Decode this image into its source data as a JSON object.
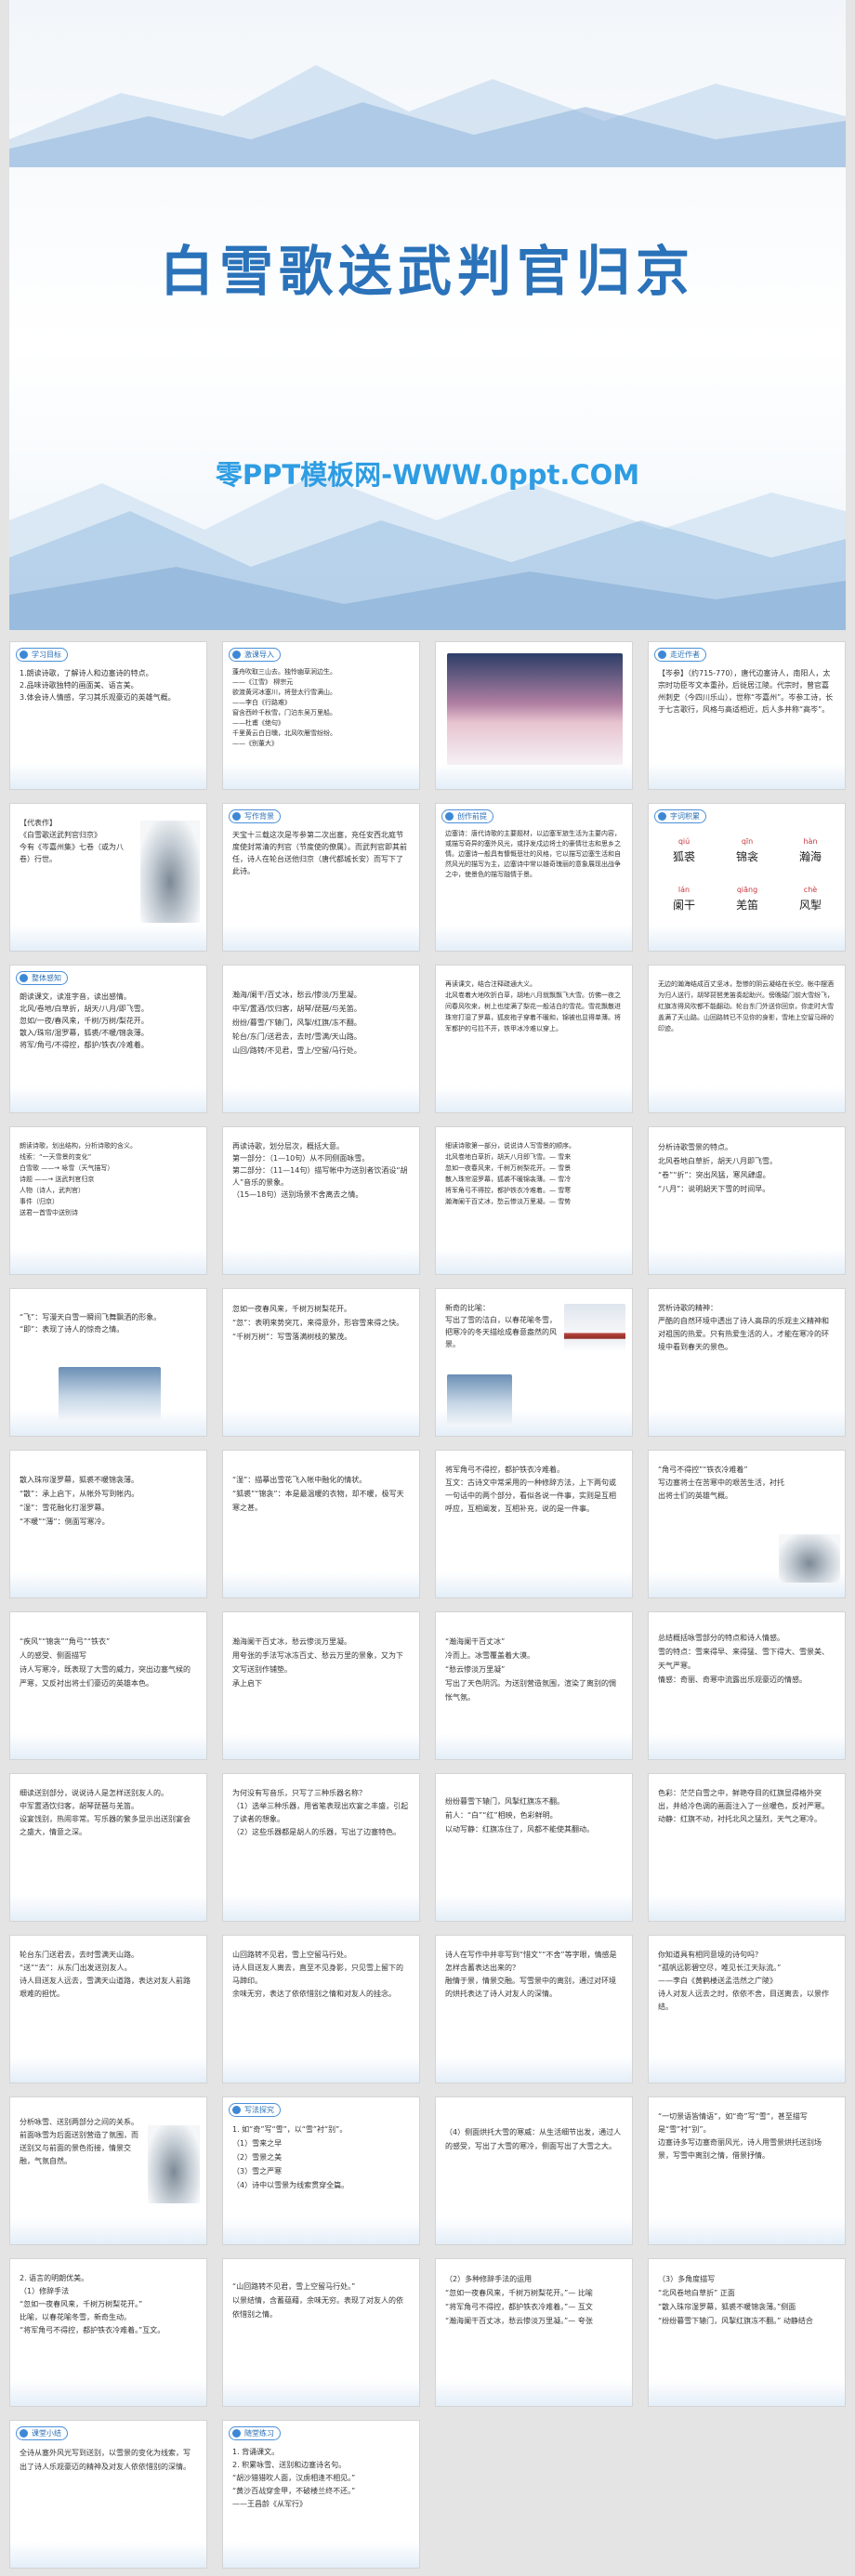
{
  "hero": {
    "title": "白雪歌送武判官归京",
    "subtitle": "零PPT模板网-WWW.0ppt.COM"
  },
  "tags": {
    "s1": "学习目标",
    "s2": "激课导入",
    "s4": "走近作者",
    "s6": "写作背景",
    "s7": "创作前提",
    "s8": "字词积累",
    "s9": "整体感知",
    "s19": "细读课文",
    "s41": "课堂小结",
    "s42": "随堂练习",
    "s37": "写法探究"
  },
  "slides": {
    "s1": "1.朗读诗歌，了解诗人和边塞诗的特点。\n2.品味诗歌独特的画面美、语言美。\n3.体会诗人情感，学习其乐观豪迈的英雄气概。",
    "s2": "蓬舟吹取三山去。独怜幽草涧边生。\n——《江雪》 柳宗元\n欲渡黄河冰塞川，将登太行雪满山。\n——李白《行路难》\n窗含西岭千秋雪，门泊东吴万里船。\n——杜甫《绝句》\n千里黄云白日曛，北风吹雁雪纷纷。\n——《别董大》",
    "s4": "【岑参】（约715-770），唐代边塞诗人，南阳人，太宗时功臣岑文本重孙，后徙居江陵。代宗时，曾官嘉州刺史（今四川乐山），世称“岑嘉州”。岑参工诗，长于七言歌行，风格与高适相近，后人多并称“高岑”。",
    "s5": "【代表作】\n《白雪歌送武判官归京》\n今有《岑嘉州集》七卷（或为八卷）行世。",
    "s6": "天宝十三载这次是岑参第二次出塞，充任安西北庭节度使封常清的判官（节度使的僚属）。而武判官即其前任，诗人在轮台送他归京（唐代都城长安）而写下了此诗。",
    "s7": "边塞诗：唐代诗歌的主要题材，以边塞军旅生活为主要内容，或描写奇异的塞外风光，或抒发戍边将士的豪情壮志和思乡之情。边塞诗一般具有慷慨悲壮的风格，它以描写边塞生活和自然风光的描写为主，边塞诗中常以雄奇瑰丽的意象展现出战争之中，使景色的描写融情于景。",
    "s8_pinyin": [
      "qiú",
      "qīn",
      "hàn",
      "lán",
      "qiāng",
      "chè"
    ],
    "s8_words": [
      "狐裘",
      "锦衾",
      "瀚海",
      "阑干",
      "羌笛",
      "风掣"
    ],
    "s9": "朗读课文，读准字音，读出感情。\n北风/卷地/白草折，胡天/八月/即飞雪。\n忽如/一夜/春风来，千树/万树/梨花开。\n散入/珠帘/湿罗幕，狐裘/不暖/锦衾薄。\n将军/角弓/不得控，都护/铁衣/冷难着。",
    "s10": "瀚海/阑干/百丈冰，愁云/惨淡/万里凝。\n中军/置酒/饮归客，胡琴/琵琶/与羌笛。\n纷纷/暮雪/下辕门，风掣/红旗/冻不翻。\n轮台/东门/送君去，去时/雪满/天山路。\n山回/路转/不见君，雪上/空留/马行处。",
    "s11": "再读课文，结合注释疏通大义。\n北风卷着大地吹折白草，胡地八月就飘飘飞大雪。仿佛一夜之间春风吹来，树上也绽满了梨花一般洁白的雪花。雪花飘散进珠帘打湿了罗幕，狐皮袍子穿着不暖和，锦被也显得单薄。将军都护的弓拉不开，铁甲冰冷难以穿上。",
    "s12": "无边的瀚海结成百丈坚冰，愁惨的阴云凝结在长空。帐中摆酒为归人送行，胡琴琵琶羌笛奏起助兴。傍晚辕门前大雪纷飞，红旗冻得风吹都不能翻动。轮台东门外送你回京，你走时大雪盖满了天山路。山回路转已不见你的身影，雪地上空留马蹄的印迹。",
    "s13": "朗读诗歌，划出结构，分析诗歌的含义。\n线索：“一天雪景的变化”\n白雪歌 ——→ 咏雪（天气描写）\n诗题 ——→ 送武判官归京\n人物（诗人，武判官）\n事件（归京）\n送君一首雪中送别诗",
    "s14": "再读诗歌，划分层次，概括大意。\n第一部分：（1—10句）从不同侧面咏雪。\n第二部分：（11—14句）描写帐中为送别者饮酒设“胡人”音乐的景象。\n（15—18句）送别场景不舍离去之情。",
    "s15": "细读诗歌第一部分，说说诗人写雪景的顺序。\n北风卷地白草折，胡天八月即飞雪。— 雪来\n忽如一夜春风来，千树万树梨花开。— 雪景\n散入珠帘湿罗幕，狐裘不暖锦衾薄。— 雪冷\n将军角弓不得控，都护铁衣冷难着。— 雪寒\n瀚海阑干百丈冰，愁云惨淡万里凝。— 雪势",
    "s16": "分析诗歌雪景的特点。\n北风卷地白草折，胡天八月即飞雪。\n“卷”“折”：突出风猛，寒风肆虐。\n“八月”：说明胡天下雪的时间早。",
    "s17": "“飞”：写漫天白雪一瞬间飞舞飘洒的形象。\n“即”：表现了诗人的惊奇之情。",
    "s18": "忽如一夜春风来，千树万树梨花开。\n“忽”：表明来势突兀，来得意外，形容雪来得之快。\n“千树万树”：写雪落满树枝的繁茂。",
    "s19": "新奇的比喻：\n写出了雪的洁白，以春花喻冬雪，把寒冷的冬天描绘成春意盎然的风景。",
    "s20": "赏析诗歌的精神：\n严酷的自然环境中透出了诗人高昂的乐观主义精神和对祖国的热爱。只有热爱生活的人，才能在寒冷的环境中看到春天的景色。",
    "s21": "散入珠帘湿罗幕，狐裘不暖锦衾薄。\n“散”：承上启下，从帐外写到帐内。\n“湿”：雪花融化打湿罗幕。\n“不暖”“薄”：侧面写寒冷。",
    "s22": "“湿”：描摹出雪花飞入帐中融化的情状。\n“狐裘”“锦衾”：本是最温暖的衣物，却不暖，极写天寒之甚。",
    "s23": "将军角弓不得控，都护铁衣冷难着。\n互文：古诗文中常采用的一种修辞方法，上下两句或一句话中的两个部分，看似各说一件事，实则是互相呼应，互相阐发，互相补充，说的是一件事。",
    "s24": "“角弓不得控”“铁衣冷难着”\n写边塞将士在苦寒中的艰苦生活，衬托出将士们的英雄气概。",
    "s25": "“疾风”“锦衾”“角弓”“铁衣”\n人的感受、侧面描写\n诗人写寒冷，既表现了大雪的威力，突出边塞气候的严寒，又反衬出将士们豪迈的英雄本色。",
    "s26": "瀚海阑干百丈冰，愁云惨淡万里凝。\n用夸张的手法写冰冻百丈、愁云万里的景象，又为下文写送别作铺垫。\n承上启下",
    "s27": "“瀚海阑干百丈冰”\n冷而上。冰雪覆盖着大漠。\n“愁云惨淡万里凝”\n写出了天色阴沉。为送别营造氛围，渲染了离别的惆怅气氛。",
    "s28": "总结概括咏雪部分的特点和诗人情感。\n雪的特点：雪来得早、来得猛、雪下得大、雪景美、天气严寒。\n情感：奇丽、奇寒中流露出乐观豪迈的情感。",
    "s29": "细读送别部分，说说诗人是怎样送别友人的。\n中军置酒饮归客，胡琴琵琶与羌笛。\n设宴饯别，热闹非常。写乐器的繁多显示出送别宴会之盛大，情意之深。",
    "s30": "为何没有写音乐，只写了三种乐器名称？\n（1）选举三种乐器，用省笔表现出欢宴之丰盛，引起了读者的想象。\n（2）这些乐器都是胡人的乐器，写出了边塞特色。",
    "s31": "纷纷暮雪下辕门，风掣红旗冻不翻。\n前人：“白”“红”相映，色彩鲜明。\n以动写静：红旗冻住了，风都不能使其翻动。",
    "s32": "色彩：茫茫白雪之中，鲜艳夺目的红旗显得格外突出，并给冷色调的画面注入了一丝暖色，反衬严寒。\n动静：红旗不动，衬托北风之猛烈，天气之寒冷。",
    "s33": "轮台东门送君去，去时雪满天山路。\n“送”“去”：从东门出发送别友人。\n诗人目送友人远去，雪满天山道路，表达对友人前路艰难的担忧。",
    "s34": "山回路转不见君，雪上空留马行处。\n诗人目送友人离去，直至不见身影，只见雪上留下的马蹄印。\n余味无穷，表达了依依惜别之情和对友人的挂念。",
    "s35": "诗人在写作中并非写到“惜文”“不舍”等字眼，情感是怎样含蓄表达出来的？\n融情于景，情景交融。写雪景中的离别，通过对环境的烘托表达了诗人对友人的深情。",
    "s36": "你知道具有相同意境的诗句吗？\n“孤帆远影碧空尽，唯见长江天际流。”\n——李白《黄鹤楼送孟浩然之广陵》\n诗人对友人远去之时，依依不舍，目送离去，以景作结。",
    "s37": "分析咏雪、送别两部分之间的关系。\n前面咏雪为后面送别营造了氛围，而送别又与前面的景色衔接，情景交融，气氛自然。",
    "s38": "1. 如“奇”写“雪”，以“雪”衬“别”。\n（1）雪来之早\n（2）雪景之美\n（3）雪之严寒\n（4）诗中以雪景为线索贯穿全篇。",
    "s39": "（4）侧面烘托大雪的寒威：从生活细节出发，通过人的感受，写出了大雪的寒冷，侧面写出了大雪之大。",
    "s40": "“一切景语皆情语”，如“奇”写“雪”，甚至描写是“雪”衬“别”。\n边塞诗多写边塞奇丽风光，诗人用雪景烘托送别场景，写雪中离别之情，借景抒情。",
    "s41": "2. 语言的明朗优美。\n（1）修辞手法\n“忽如一夜春风来，千树万树梨花开。”\n比喻，以春花喻冬雪，新奇生动。\n“将军角弓不得控，都护铁衣冷难着。”互文。",
    "s42": "“山回路转不见君，雪上空留马行处。”\n以景结情，含蓄蕴藉，余味无穷。表现了对友人的依依惜别之情。",
    "s43": "（2）多种修辞手法的运用\n“忽如一夜春风来，千树万树梨花开。”— 比喻\n“将军角弓不得控，都护铁衣冷难着。”— 互文\n“瀚海阑干百丈冰，愁云惨淡万里凝。”— 夸张",
    "s44": "（3）多角度描写\n“北风卷地白草折” 正面\n“散入珠帘湿罗幕，狐裘不暖锦衾薄。”侧面\n“纷纷暮雪下辕门，风掣红旗冻不翻。” 动静结合",
    "s45": "全诗从塞外风光写到送别，以雪景的变化为线索，写出了诗人乐观豪迈的精神及对友人依依惜别的深情。",
    "s46": "1. 背诵课文。\n2. 积累咏雪、送别和边塞诗名句。\n“胡沙猎猎吹人面，汉虏相逢不相见。”\n“黄沙百战穿金甲，不破楼兰终不还。”\n——王昌龄《从军行》"
  }
}
